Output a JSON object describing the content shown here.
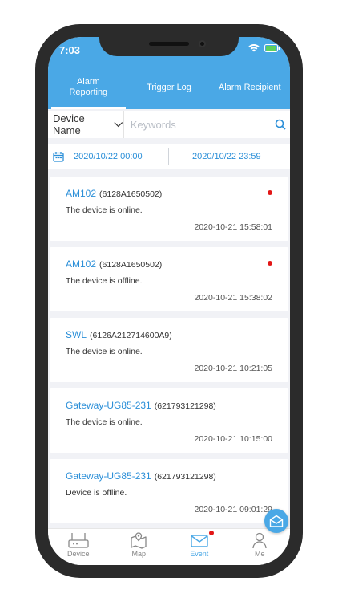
{
  "status_bar": {
    "time": "7:03"
  },
  "tabs": [
    {
      "label": "Alarm\nReporting",
      "active": true
    },
    {
      "label": "Trigger Log",
      "active": false
    },
    {
      "label": "Alarm Recipient",
      "active": false
    }
  ],
  "filter": {
    "selected": "Device Name",
    "keyword_placeholder": "Keywords",
    "keyword_value": ""
  },
  "date_range": {
    "start": "2020/10/22 00:00",
    "end": "2020/10/22 23:59"
  },
  "events": [
    {
      "device": "AM102",
      "sn": "(6128A1650502)",
      "message": "The device is online.",
      "timestamp": "2020-10-21 15:58:01",
      "unread": true
    },
    {
      "device": "AM102",
      "sn": "(6128A1650502)",
      "message": "The device is offline.",
      "timestamp": "2020-10-21 15:38:02",
      "unread": true
    },
    {
      "device": "SWL",
      "sn": "(6126A212714600A9)",
      "message": "The device is online.",
      "timestamp": "2020-10-21 10:21:05",
      "unread": false
    },
    {
      "device": "Gateway-UG85-231",
      "sn": "(621793121298)",
      "message": "The device is online.",
      "timestamp": "2020-10-21 10:15:00",
      "unread": false
    },
    {
      "device": "Gateway-UG85-231",
      "sn": "(621793121298)",
      "message": "Device is offline.",
      "timestamp": "2020-10-21 09:01:29",
      "unread": false
    }
  ],
  "bottom_nav": [
    {
      "label": "Device",
      "icon": "router-icon",
      "active": false,
      "badge": false
    },
    {
      "label": "Map",
      "icon": "map-icon",
      "active": false,
      "badge": false
    },
    {
      "label": "Event",
      "icon": "envelope-icon",
      "active": true,
      "badge": true
    },
    {
      "label": "Me",
      "icon": "person-icon",
      "active": false,
      "badge": false
    }
  ],
  "colors": {
    "accent": "#4aa8e6",
    "link": "#2b8fd8",
    "badge": "#e21616",
    "background": "#f1f2f6"
  }
}
